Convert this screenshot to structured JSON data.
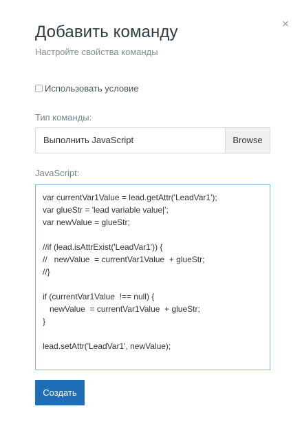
{
  "dialog": {
    "title": "Добавить команду",
    "subtitle": "Настройте свойства команды",
    "close_glyph": "×",
    "use_condition_label": "Использовать условие",
    "use_condition_checked": false,
    "command_type_label": "Тип команды:",
    "command_type_value": "Выполнить JavaScript",
    "browse_label": "Browse",
    "javascript_label": "JavaScript:",
    "code_lines": [
      "var currentVar1Value = lead.getAttr('LeadVar1');",
      "var glueStr = 'lead variable value|';",
      "var newValue = glueStr;",
      "",
      "//if (lead.isAttrExist('LeadVar1')) {",
      "//   newValue  = currentVar1Value  + glueStr;",
      "//}",
      "",
      "if (currentVar1Value  !== null) {",
      "   newValue  = currentVar1Value  + glueStr;",
      "}",
      "",
      "lead.setAttr('LeadVar1', newValue);"
    ],
    "create_label": "Создать"
  },
  "colors": {
    "primary_button": "#1f6fb8",
    "focus_border": "#7fb2d8",
    "muted_text": "#7f8c97"
  }
}
